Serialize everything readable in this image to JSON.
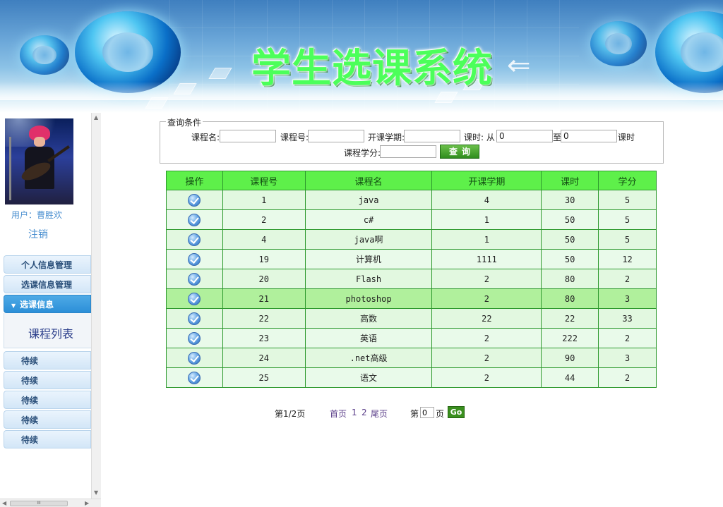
{
  "banner": {
    "title": "学生选课系统"
  },
  "sidebar": {
    "user_label": "用户：曹胜欢",
    "logout": "注销",
    "menu": [
      {
        "label": "个人信息管理",
        "active": false
      },
      {
        "label": "选课信息管理",
        "active": false
      },
      {
        "label": "选课信息",
        "active": true
      },
      {
        "label": "待续",
        "active": false
      },
      {
        "label": "待续",
        "active": false
      },
      {
        "label": "待续",
        "active": false
      },
      {
        "label": "待续",
        "active": false
      },
      {
        "label": "待续",
        "active": false
      }
    ],
    "submenu": {
      "link": "课程列表"
    },
    "scroll_thumb_glyph": "III"
  },
  "query": {
    "legend": "查询条件",
    "course_name_label": "课程名:",
    "course_name_value": "",
    "course_no_label": "课程号:",
    "course_no_value": "",
    "term_label": "开课学期:",
    "term_value": "",
    "hours_label": "课时: 从",
    "hours_from": "0",
    "hours_to_label": "至",
    "hours_to": "0",
    "hours_unit": "课时",
    "credit_label": "课程学分:",
    "credit_value": "",
    "search_button": "查询"
  },
  "table": {
    "headers": [
      "操作",
      "课程号",
      "课程名",
      "开课学期",
      "课时",
      "学分"
    ],
    "rows": [
      [
        "1",
        "java",
        "4",
        "30",
        "5"
      ],
      [
        "2",
        "c#",
        "1",
        "50",
        "5"
      ],
      [
        "4",
        "java啊",
        "1",
        "50",
        "5"
      ],
      [
        "19",
        "计算机",
        "1111",
        "50",
        "12"
      ],
      [
        "20",
        "Flash",
        "2",
        "80",
        "2"
      ],
      [
        "21",
        "photoshop",
        "2",
        "80",
        "3"
      ],
      [
        "22",
        "高数",
        "22",
        "22",
        "33"
      ],
      [
        "23",
        "英语",
        "2",
        "222",
        "2"
      ],
      [
        "24",
        ".net高级",
        "2",
        "90",
        "3"
      ],
      [
        "25",
        "语文",
        "2",
        "44",
        "2"
      ]
    ],
    "highlighted_row": 5
  },
  "pager": {
    "info": "第1/2页",
    "first": "首页",
    "page1": "1",
    "page2": "2",
    "last": "尾页",
    "jump_prefix": "第",
    "jump_value": "0",
    "jump_suffix": "页",
    "go": "Go"
  },
  "colors": {
    "header_green": "#5ef04a",
    "border_green": "#2e9a2e",
    "accent_blue": "#2c8fd8"
  }
}
